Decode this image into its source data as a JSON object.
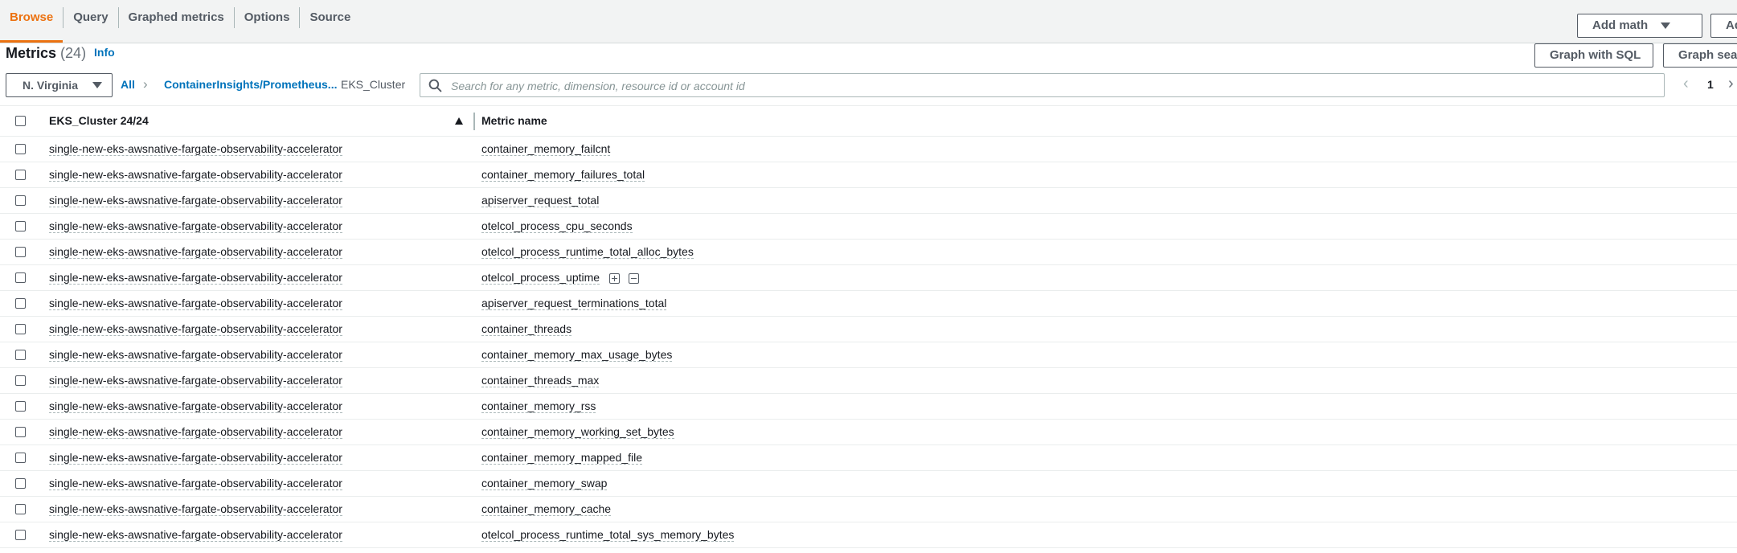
{
  "tabs": [
    {
      "label": "Browse",
      "active": true
    },
    {
      "label": "Query",
      "active": false
    },
    {
      "label": "Graphed metrics",
      "active": false
    },
    {
      "label": "Options",
      "active": false
    },
    {
      "label": "Source",
      "active": false
    }
  ],
  "toolbar": {
    "add_math": "Add math",
    "add_query": "Add q",
    "graph_with_sql": "Graph with SQL",
    "graph_search": "Graph sear"
  },
  "header": {
    "title": "Metrics",
    "count": "(24)",
    "info": "Info"
  },
  "filter": {
    "region": "N. Virginia",
    "crumb_all": "All",
    "crumb_namespace": "ContainerInsights/Prometheus...",
    "crumb_dimension": "EKS_Cluster",
    "search_placeholder": "Search for any metric, dimension, resource id or account id"
  },
  "pagination": {
    "page": "1"
  },
  "table": {
    "columns": [
      "EKS_Cluster 24/24",
      "Metric name"
    ],
    "rows": [
      {
        "cluster": "single-new-eks-awsnative-fargate-observability-accelerator",
        "metric": "container_memory_failcnt"
      },
      {
        "cluster": "single-new-eks-awsnative-fargate-observability-accelerator",
        "metric": "container_memory_failures_total"
      },
      {
        "cluster": "single-new-eks-awsnative-fargate-observability-accelerator",
        "metric": "apiserver_request_total"
      },
      {
        "cluster": "single-new-eks-awsnative-fargate-observability-accelerator",
        "metric": "otelcol_process_cpu_seconds"
      },
      {
        "cluster": "single-new-eks-awsnative-fargate-observability-accelerator",
        "metric": "otelcol_process_runtime_total_alloc_bytes"
      },
      {
        "cluster": "single-new-eks-awsnative-fargate-observability-accelerator",
        "metric": "otelcol_process_uptime"
      },
      {
        "cluster": "single-new-eks-awsnative-fargate-observability-accelerator",
        "metric": "apiserver_request_terminations_total"
      },
      {
        "cluster": "single-new-eks-awsnative-fargate-observability-accelerator",
        "metric": "container_threads"
      },
      {
        "cluster": "single-new-eks-awsnative-fargate-observability-accelerator",
        "metric": "container_memory_max_usage_bytes"
      },
      {
        "cluster": "single-new-eks-awsnative-fargate-observability-accelerator",
        "metric": "container_threads_max"
      },
      {
        "cluster": "single-new-eks-awsnative-fargate-observability-accelerator",
        "metric": "container_memory_rss"
      },
      {
        "cluster": "single-new-eks-awsnative-fargate-observability-accelerator",
        "metric": "container_memory_working_set_bytes"
      },
      {
        "cluster": "single-new-eks-awsnative-fargate-observability-accelerator",
        "metric": "container_memory_mapped_file"
      },
      {
        "cluster": "single-new-eks-awsnative-fargate-observability-accelerator",
        "metric": "container_memory_swap"
      },
      {
        "cluster": "single-new-eks-awsnative-fargate-observability-accelerator",
        "metric": "container_memory_cache"
      },
      {
        "cluster": "single-new-eks-awsnative-fargate-observability-accelerator",
        "metric": "otelcol_process_runtime_total_sys_memory_bytes"
      }
    ]
  }
}
